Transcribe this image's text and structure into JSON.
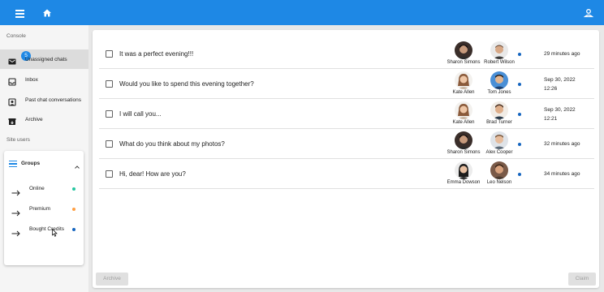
{
  "appbar": {
    "color": "#1e88e5",
    "left_icons": [
      "menu-icon",
      "home-icon"
    ],
    "right_icons": [
      "account-icon"
    ]
  },
  "sidebar": {
    "console_label": "Console",
    "nav": [
      {
        "label": "Unassigned chats",
        "icon": "inbox-alert-icon",
        "badge": "5",
        "active": true
      },
      {
        "label": "Inbox",
        "icon": "inbox-icon"
      },
      {
        "label": "Past chat conversations",
        "icon": "history-icon"
      },
      {
        "label": "Archive",
        "icon": "archive-icon"
      }
    ],
    "site_users_label": "Site users",
    "groups": {
      "label": "Groups",
      "icon": "list-icon",
      "expanded": true,
      "items": [
        {
          "label": "Online",
          "icon": "arrow-right-icon",
          "dot_color": "#26c6a0"
        },
        {
          "label": "Premium",
          "icon": "arrow-right-icon",
          "dot_color": "#ff9f43"
        },
        {
          "label": "Bought Credits",
          "icon": "arrow-right-icon",
          "dot_color": "#1565c0"
        }
      ]
    }
  },
  "chats": [
    {
      "message": "It was a perfect evening!!!",
      "from": "Sharon Simons",
      "to": "Robert Wilson",
      "time": [
        "29 minutes ago"
      ]
    },
    {
      "message": "Would you like to spend this evening together?",
      "from": "Kate Allen",
      "to": "Tom Jones",
      "time": [
        "Sep 30, 2022",
        "12:26"
      ]
    },
    {
      "message": "I will call you...",
      "from": "Kate Allen",
      "to": "Brad Turner",
      "time": [
        "Sep 30, 2022",
        "12:21"
      ]
    },
    {
      "message": "What do you think about my photos?",
      "from": "Sharon Simons",
      "to": "Alex Cooper",
      "time": [
        "32 minutes ago"
      ]
    },
    {
      "message": "Hi, dear! How are you?",
      "from": "Emma Dowson",
      "to": "Leo Nelson",
      "time": [
        "34 minutes ago"
      ]
    }
  ],
  "actions": {
    "archive": "Archive",
    "claim": "Claim"
  }
}
